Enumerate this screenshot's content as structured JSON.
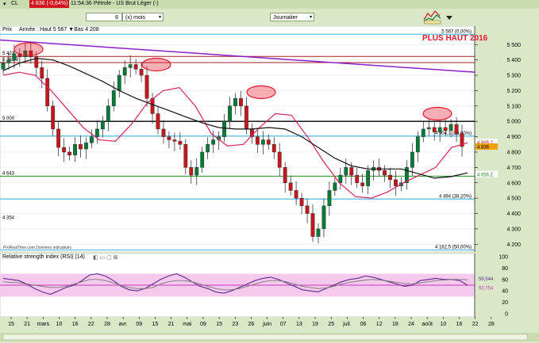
{
  "title_bar": {
    "instrument": "CL",
    "price_badge": "4 836 (-0,64%)",
    "time": "11:54:36",
    "name": "Pétrole - US Brut Léger (-)"
  },
  "toolbar": {
    "period_value": "6",
    "period_unit": "(x) mois",
    "interval": "Journalier"
  },
  "main_panel": {
    "label": "Prix",
    "info": "Année : Haut 5 567 ▼Bas 4 208",
    "annotation": "PLUS HAUT 2016",
    "source": "ProRealTime.com Données indicatives",
    "left_labels": [
      "5 423",
      "5 382,9",
      "5 000",
      "4 643",
      "4 354"
    ],
    "fib_labels": [
      "5 567 (0,00%)",
      "4 904,1 (23,60%)",
      "4 494 (38,20%)",
      "4 162,5 (50,00%)"
    ],
    "price_badges": [
      "4 865,2",
      "4 836",
      "4 656,2"
    ],
    "y_ticks": [
      "5 500",
      "5 400",
      "5 300",
      "5 200",
      "5 100",
      "5 000",
      "4 900",
      "4 800",
      "4 700",
      "4 600",
      "4 500",
      "4 400",
      "4 300",
      "4 200"
    ]
  },
  "rsi_panel": {
    "label": "Relative strength index (RSI) (14)",
    "value_labels": [
      "59,544",
      "50,754"
    ],
    "y_ticks": [
      "100",
      "80",
      "60",
      "40",
      "20",
      "0"
    ]
  },
  "x_axis": {
    "labels": [
      "15",
      "21",
      "mars",
      "10",
      "16",
      "22",
      "28",
      "avr.",
      "09",
      "15",
      "21",
      "mai",
      "09",
      "15",
      "23",
      "26",
      "juin",
      "07",
      "13",
      "19",
      "25",
      "juil.",
      "06",
      "12",
      "18",
      "24",
      "août",
      "10",
      "16",
      "22",
      "28"
    ]
  },
  "colors": {
    "background": "#dbe8c8",
    "annotation_red": "#e8162a",
    "candle_up": "#007a37",
    "candle_down": "#c4161c",
    "ma_red": "#d6245a",
    "ma_black": "#111111",
    "trendline": "#8b1fc8",
    "fib_line": "#33b4e6",
    "rsi_band": "#f5c8ee"
  },
  "chart_data": [
    {
      "type": "candlestick",
      "title": "Pétrole - US Brut Léger",
      "ylim": [
        4150,
        5620
      ],
      "x_ticks": [
        "15",
        "21",
        "mars",
        "10",
        "16",
        "22",
        "28",
        "avr.",
        "09",
        "15",
        "21",
        "mai",
        "09",
        "15",
        "23",
        "26",
        "juin",
        "07",
        "13",
        "19",
        "25",
        "juil.",
        "06",
        "12",
        "18",
        "24",
        "août",
        "10",
        "16",
        "22",
        "28"
      ],
      "close": [
        5380,
        5400,
        5440,
        5420,
        5460,
        5420,
        5350,
        5280,
        5100,
        4950,
        4830,
        4800,
        4780,
        4850,
        4820,
        4860,
        4900,
        4950,
        5000,
        5100,
        5200,
        5300,
        5350,
        5370,
        5340,
        5300,
        5150,
        5050,
        4950,
        4900,
        4880,
        4870,
        4850,
        4700,
        4650,
        4700,
        4800,
        4850,
        4880,
        4900,
        5000,
        5100,
        5150,
        5100,
        4950,
        4900,
        4850,
        4880,
        4850,
        4800,
        4700,
        4600,
        4550,
        4500,
        4450,
        4400,
        4250,
        4300,
        4450,
        4550,
        4600,
        4650,
        4700,
        4650,
        4600,
        4580,
        4680,
        4700,
        4680,
        4650,
        4620,
        4580,
        4600,
        4700,
        4800,
        4900,
        4950,
        4960,
        4930,
        4960,
        4940,
        4980,
        4920,
        4836
      ],
      "ma_red": [
        5300,
        5320,
        5300,
        5200,
        5080,
        4960,
        4880,
        4870,
        4980,
        5120,
        5200,
        5220,
        5100,
        4920,
        4840,
        4850,
        4960,
        5050,
        5040,
        4900,
        4740,
        4600,
        4510,
        4500,
        4540,
        4600,
        4650,
        4700,
        4830,
        4860
      ],
      "ma_black": [
        5330,
        5380,
        5410,
        5400,
        5360,
        5310,
        5260,
        5200,
        5150,
        5110,
        5070,
        5030,
        4990,
        4960,
        4950,
        4950,
        4960,
        4950,
        4900,
        4830,
        4760,
        4710,
        4690,
        4690,
        4690,
        4660,
        4630,
        4640,
        4665
      ],
      "trendline": [
        5530,
        5320
      ],
      "levels": [
        5000,
        4904.1,
        4643,
        4494,
        5423,
        5382.9
      ]
    },
    {
      "type": "line",
      "title": "Relative strength index (RSI) (14)",
      "ylim": [
        0,
        100
      ],
      "bands": [
        30,
        70
      ],
      "series": [
        {
          "name": "RSI",
          "values": [
            62,
            60,
            58,
            52,
            44,
            38,
            34,
            40,
            46,
            50,
            58,
            68,
            70,
            66,
            58,
            48,
            42,
            40,
            44,
            52,
            60,
            66,
            70,
            64,
            56,
            48,
            44,
            38,
            36,
            40,
            46,
            52,
            58,
            62,
            64,
            60,
            54,
            48,
            42,
            40,
            38,
            44,
            50,
            56,
            60,
            62,
            66,
            64,
            60,
            56,
            52,
            48,
            50,
            58,
            60,
            62,
            60,
            60,
            58,
            50
          ]
        },
        {
          "name": "Signal",
          "values": [
            56,
            55,
            54,
            52,
            50,
            48,
            46,
            46,
            48,
            52,
            56,
            60,
            60,
            58,
            54,
            50,
            46,
            44,
            44,
            46,
            52,
            56,
            58,
            58,
            56,
            52,
            48,
            44,
            42,
            42,
            44,
            48,
            52,
            56,
            58,
            58,
            56,
            52,
            48,
            46,
            44,
            45,
            48,
            52,
            55,
            57,
            59,
            60,
            59,
            57,
            55,
            53,
            52,
            54,
            56,
            58,
            59,
            60,
            60,
            59.5
          ]
        }
      ]
    }
  ]
}
